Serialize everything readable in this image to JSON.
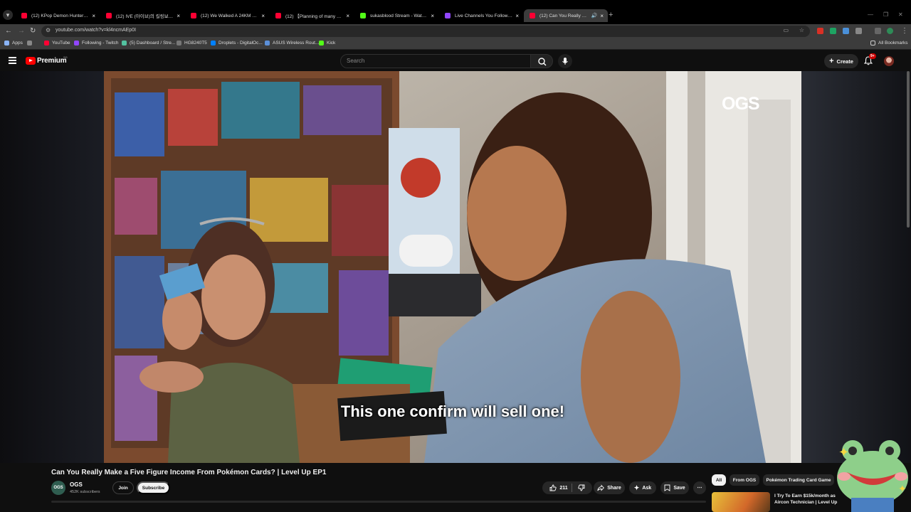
{
  "browser": {
    "tabs": [
      {
        "title": "(12) KPop Demon Hunters | Ho",
        "color": "#ff0033"
      },
      {
        "title": "(12) IVE (아이브)의 킬링보이스 ",
        "color": "#ff0033"
      },
      {
        "title": "(12) We Walked A 24KM TRAIL",
        "color": "#ff0033"
      },
      {
        "title": "(12) 【Planning of many people",
        "color": "#ff0033"
      },
      {
        "title": "sukasblood Stream - Watch Liv",
        "color": "#53fc18"
      },
      {
        "title": "Live Channels You Follow - Twi",
        "color": "#9146ff"
      },
      {
        "title": "(12) Can You Really Make a",
        "color": "#ff0033",
        "active": true
      }
    ],
    "url": "youtube.com/watch?v=kl4ncmAEp0I",
    "bookmarks": [
      {
        "label": "Apps",
        "color": "#8ab4f8"
      },
      {
        "label": "YouTube",
        "color": "#ff0033"
      },
      {
        "label": "Following - Twitch",
        "color": "#9146ff"
      },
      {
        "label": "(5) Dashboard / Stre...",
        "color": "#53c2a0"
      },
      {
        "label": "HG8240T5",
        "color": "#777777"
      },
      {
        "label": "Droplets - DigitalOc...",
        "color": "#0080ff"
      },
      {
        "label": "ASUS Wireless Rout...",
        "color": "#5b8fd8"
      },
      {
        "label": "Kick",
        "color": "#53fc18"
      }
    ],
    "all_bookmarks": "All Bookmarks"
  },
  "youtube": {
    "brand": "Premium",
    "country_code": "SG",
    "search_placeholder": "Search",
    "create_label": "Create",
    "notification_badge": "9+"
  },
  "video": {
    "caption": "This one confirm will sell one!",
    "watermark": "OGS",
    "title": "Can You Really Make a Five Figure Income From Pokémon Cards? | Level Up EP1",
    "channel": {
      "name": "OGS",
      "subscribers": "452K subscribers",
      "avatar_text": "OGS"
    },
    "join_label": "Join",
    "subscribe_label": "Subscribe",
    "likes": "211",
    "share_label": "Share",
    "ask_label": "Ask",
    "save_label": "Save"
  },
  "related": {
    "chips": [
      {
        "label": "All",
        "selected": true
      },
      {
        "label": "From OGS",
        "selected": false
      },
      {
        "label": "Pokémon Trading Card Game",
        "selected": false
      }
    ],
    "first_title": "I Try To Earn $15k/month as Aircon Technician | Level Up"
  }
}
